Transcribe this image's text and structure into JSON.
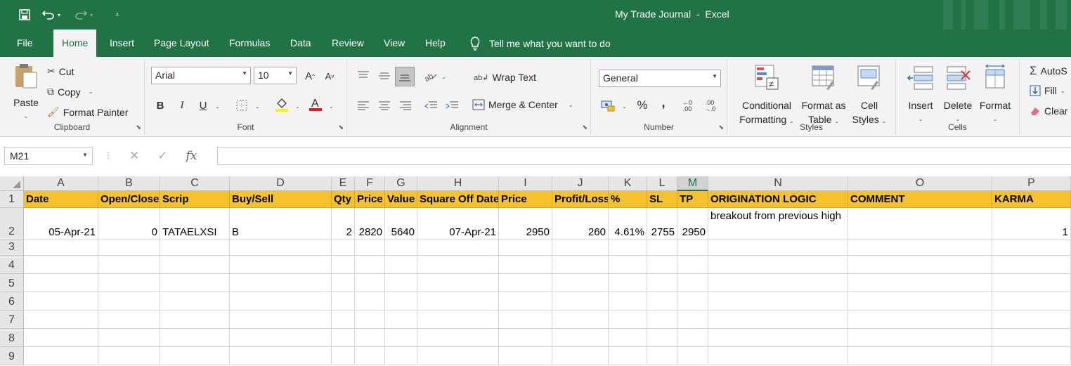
{
  "window": {
    "title": "My Trade Journal  -  Excel"
  },
  "menu": {
    "tabs": [
      "File",
      "Home",
      "Insert",
      "Page Layout",
      "Formulas",
      "Data",
      "Review",
      "View",
      "Help"
    ],
    "active": "Home",
    "tell_me": "Tell me what you want to do"
  },
  "ribbon": {
    "clipboard": {
      "paste": "Paste",
      "cut": "Cut",
      "copy": "Copy",
      "format_painter": "Format Painter",
      "label": "Clipboard"
    },
    "font": {
      "name": "Arial",
      "size": "10",
      "bold": "B",
      "italic": "I",
      "underline": "U",
      "label": "Font"
    },
    "alignment": {
      "wrap_text": "Wrap Text",
      "merge_center": "Merge & Center",
      "label": "Alignment"
    },
    "number": {
      "format": "General",
      "percent": "%",
      "comma": ",",
      "label": "Number"
    },
    "styles": {
      "conditional": "Conditional",
      "formatting": "Formatting",
      "format_as": "Format as",
      "table": "Table",
      "cell": "Cell",
      "cell_styles": "Styles",
      "label": "Styles"
    },
    "cells": {
      "insert": "Insert",
      "delete": "Delete",
      "format": "Format",
      "label": "Cells"
    },
    "editing": {
      "autosum": "AutoS",
      "fill": "Fill",
      "clear": "Clear"
    }
  },
  "formula_bar": {
    "name_box": "M21",
    "fx": "fx",
    "value": ""
  },
  "sheet": {
    "columns": [
      "A",
      "B",
      "C",
      "D",
      "E",
      "F",
      "G",
      "H",
      "I",
      "J",
      "K",
      "L",
      "M",
      "N",
      "O",
      "P"
    ],
    "selected_column": "M",
    "rows": [
      "1",
      "2",
      "3",
      "4",
      "5",
      "6",
      "7",
      "8",
      "9"
    ],
    "header_row": [
      "Date",
      "Open/Close",
      "Scrip",
      "Buy/Sell",
      "Qty",
      "Price",
      "Value",
      "Square Off Date",
      "Price",
      "Profit/Loss",
      "%",
      "SL",
      "TP",
      "ORIGINATION LOGIC",
      "COMMENT",
      "KARMA"
    ],
    "data_row": [
      "05-Apr-21",
      "0",
      "TATAELXSI",
      "B",
      "2",
      "2820",
      "5640",
      "07-Apr-21",
      "2950",
      "260",
      "4.61%",
      "2755",
      "2950",
      "breakout from previous high",
      "",
      "1"
    ],
    "header_fill": "#F4C12F"
  },
  "colors": {
    "excel_green": "#217346"
  }
}
